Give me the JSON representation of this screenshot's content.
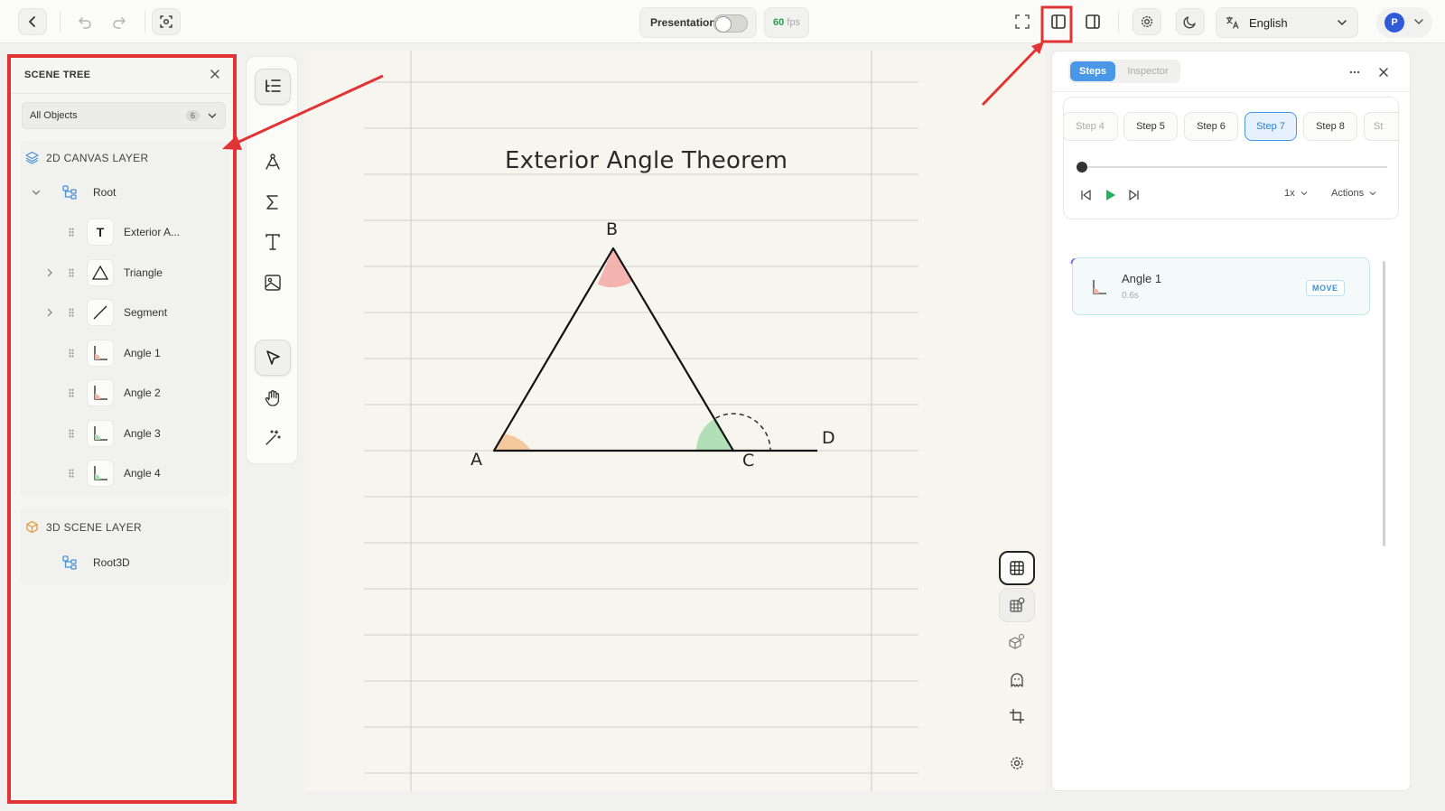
{
  "topbar": {
    "presentation_label": "Presentation",
    "fps_value": "60",
    "fps_unit": "fps",
    "language": "English",
    "avatar_initial": "P"
  },
  "scene_tree": {
    "title": "SCENE TREE",
    "filter_label": "All Objects",
    "filter_count": "6",
    "canvas_layer": {
      "title": "2D CANVAS LAYER",
      "root": "Root",
      "children": [
        {
          "label": "Exterior A...",
          "icon": "text-icon"
        },
        {
          "label": "Triangle",
          "icon": "triangle-icon"
        },
        {
          "label": "Segment",
          "icon": "segment-icon"
        },
        {
          "label": "Angle 1",
          "icon": "angle-icon"
        },
        {
          "label": "Angle 2",
          "icon": "angle-icon"
        },
        {
          "label": "Angle 3",
          "icon": "angle-icon"
        },
        {
          "label": "Angle 4",
          "icon": "angle-icon"
        }
      ]
    },
    "scene_layer": {
      "title": "3D SCENE LAYER",
      "root": "Root3D"
    }
  },
  "canvas": {
    "title": "Exterior Angle Theorem",
    "vertices": {
      "a": "A",
      "b": "B",
      "c": "C",
      "d": "D"
    }
  },
  "right_panel": {
    "tabs": {
      "steps": "Steps",
      "inspector": "Inspector"
    },
    "steps": [
      "Step 4",
      "Step 5",
      "Step 6",
      "Step 7",
      "Step 8",
      "St"
    ],
    "selected_step": "Step 7",
    "playback_position": 0,
    "speed": "1x",
    "actions_label": "Actions",
    "step_items": [
      {
        "name": "Angle 1",
        "duration": "0.6s",
        "badge": "MOVE"
      }
    ]
  },
  "colors": {
    "annotation_red": "#e23434",
    "accent_blue": "#4a97e8",
    "angle_b": "#f2a8a4",
    "angle_a": "#f5c08f",
    "angle_c": "#a9deb0"
  }
}
